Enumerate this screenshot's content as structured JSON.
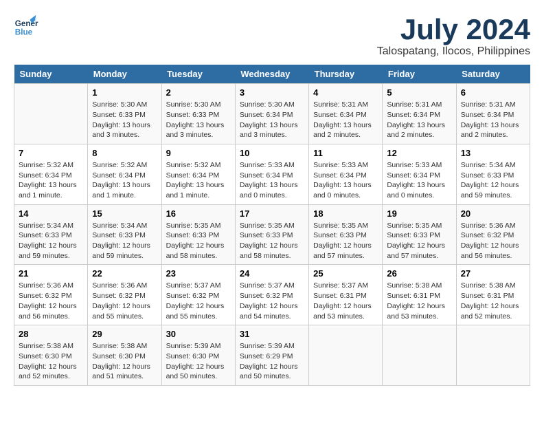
{
  "header": {
    "logo_line1": "General",
    "logo_line2": "Blue",
    "main_title": "July 2024",
    "subtitle": "Talospatang, Ilocos, Philippines"
  },
  "calendar": {
    "days_of_week": [
      "Sunday",
      "Monday",
      "Tuesday",
      "Wednesday",
      "Thursday",
      "Friday",
      "Saturday"
    ],
    "weeks": [
      [
        {
          "day": "",
          "text": ""
        },
        {
          "day": "1",
          "text": "Sunrise: 5:30 AM\nSunset: 6:33 PM\nDaylight: 13 hours\nand 3 minutes."
        },
        {
          "day": "2",
          "text": "Sunrise: 5:30 AM\nSunset: 6:33 PM\nDaylight: 13 hours\nand 3 minutes."
        },
        {
          "day": "3",
          "text": "Sunrise: 5:30 AM\nSunset: 6:34 PM\nDaylight: 13 hours\nand 3 minutes."
        },
        {
          "day": "4",
          "text": "Sunrise: 5:31 AM\nSunset: 6:34 PM\nDaylight: 13 hours\nand 2 minutes."
        },
        {
          "day": "5",
          "text": "Sunrise: 5:31 AM\nSunset: 6:34 PM\nDaylight: 13 hours\nand 2 minutes."
        },
        {
          "day": "6",
          "text": "Sunrise: 5:31 AM\nSunset: 6:34 PM\nDaylight: 13 hours\nand 2 minutes."
        }
      ],
      [
        {
          "day": "7",
          "text": "Sunrise: 5:32 AM\nSunset: 6:34 PM\nDaylight: 13 hours\nand 1 minute."
        },
        {
          "day": "8",
          "text": "Sunrise: 5:32 AM\nSunset: 6:34 PM\nDaylight: 13 hours\nand 1 minute."
        },
        {
          "day": "9",
          "text": "Sunrise: 5:32 AM\nSunset: 6:34 PM\nDaylight: 13 hours\nand 1 minute."
        },
        {
          "day": "10",
          "text": "Sunrise: 5:33 AM\nSunset: 6:34 PM\nDaylight: 13 hours\nand 0 minutes."
        },
        {
          "day": "11",
          "text": "Sunrise: 5:33 AM\nSunset: 6:34 PM\nDaylight: 13 hours\nand 0 minutes."
        },
        {
          "day": "12",
          "text": "Sunrise: 5:33 AM\nSunset: 6:34 PM\nDaylight: 13 hours\nand 0 minutes."
        },
        {
          "day": "13",
          "text": "Sunrise: 5:34 AM\nSunset: 6:33 PM\nDaylight: 12 hours\nand 59 minutes."
        }
      ],
      [
        {
          "day": "14",
          "text": "Sunrise: 5:34 AM\nSunset: 6:33 PM\nDaylight: 12 hours\nand 59 minutes."
        },
        {
          "day": "15",
          "text": "Sunrise: 5:34 AM\nSunset: 6:33 PM\nDaylight: 12 hours\nand 59 minutes."
        },
        {
          "day": "16",
          "text": "Sunrise: 5:35 AM\nSunset: 6:33 PM\nDaylight: 12 hours\nand 58 minutes."
        },
        {
          "day": "17",
          "text": "Sunrise: 5:35 AM\nSunset: 6:33 PM\nDaylight: 12 hours\nand 58 minutes."
        },
        {
          "day": "18",
          "text": "Sunrise: 5:35 AM\nSunset: 6:33 PM\nDaylight: 12 hours\nand 57 minutes."
        },
        {
          "day": "19",
          "text": "Sunrise: 5:35 AM\nSunset: 6:33 PM\nDaylight: 12 hours\nand 57 minutes."
        },
        {
          "day": "20",
          "text": "Sunrise: 5:36 AM\nSunset: 6:32 PM\nDaylight: 12 hours\nand 56 minutes."
        }
      ],
      [
        {
          "day": "21",
          "text": "Sunrise: 5:36 AM\nSunset: 6:32 PM\nDaylight: 12 hours\nand 56 minutes."
        },
        {
          "day": "22",
          "text": "Sunrise: 5:36 AM\nSunset: 6:32 PM\nDaylight: 12 hours\nand 55 minutes."
        },
        {
          "day": "23",
          "text": "Sunrise: 5:37 AM\nSunset: 6:32 PM\nDaylight: 12 hours\nand 55 minutes."
        },
        {
          "day": "24",
          "text": "Sunrise: 5:37 AM\nSunset: 6:32 PM\nDaylight: 12 hours\nand 54 minutes."
        },
        {
          "day": "25",
          "text": "Sunrise: 5:37 AM\nSunset: 6:31 PM\nDaylight: 12 hours\nand 53 minutes."
        },
        {
          "day": "26",
          "text": "Sunrise: 5:38 AM\nSunset: 6:31 PM\nDaylight: 12 hours\nand 53 minutes."
        },
        {
          "day": "27",
          "text": "Sunrise: 5:38 AM\nSunset: 6:31 PM\nDaylight: 12 hours\nand 52 minutes."
        }
      ],
      [
        {
          "day": "28",
          "text": "Sunrise: 5:38 AM\nSunset: 6:30 PM\nDaylight: 12 hours\nand 52 minutes."
        },
        {
          "day": "29",
          "text": "Sunrise: 5:38 AM\nSunset: 6:30 PM\nDaylight: 12 hours\nand 51 minutes."
        },
        {
          "day": "30",
          "text": "Sunrise: 5:39 AM\nSunset: 6:30 PM\nDaylight: 12 hours\nand 50 minutes."
        },
        {
          "day": "31",
          "text": "Sunrise: 5:39 AM\nSunset: 6:29 PM\nDaylight: 12 hours\nand 50 minutes."
        },
        {
          "day": "",
          "text": ""
        },
        {
          "day": "",
          "text": ""
        },
        {
          "day": "",
          "text": ""
        }
      ]
    ]
  }
}
